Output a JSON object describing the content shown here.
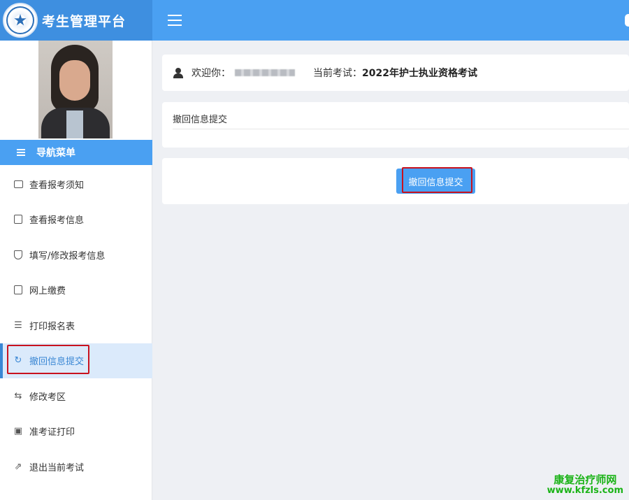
{
  "app": {
    "title": "考生管理平台"
  },
  "sidebar": {
    "nav_header": "导航菜单",
    "items": [
      {
        "label": "查看报考须知",
        "icon": "message-square-icon"
      },
      {
        "label": "查看报考信息",
        "icon": "document-icon"
      },
      {
        "label": "填写/修改报考信息",
        "icon": "shield-icon"
      },
      {
        "label": "网上缴费",
        "icon": "document-icon"
      },
      {
        "label": "打印报名表",
        "icon": "form-edit-icon"
      },
      {
        "label": "撤回信息提交",
        "icon": "refresh-icon",
        "active": true
      },
      {
        "label": "修改考区",
        "icon": "swap-icon"
      },
      {
        "label": "准考证打印",
        "icon": "image-icon"
      },
      {
        "label": "退出当前考试",
        "icon": "external-link-icon"
      }
    ]
  },
  "header": {
    "welcome_label": "欢迎你：",
    "exam_label": "当前考试：",
    "exam_name": "2022年护士执业资格考试"
  },
  "main": {
    "section_title": "撤回信息提交",
    "button_label": "撤回信息提交"
  },
  "watermark": {
    "line1": "康复治疗师网",
    "line2": "www.kfzls.com"
  },
  "colors": {
    "primary": "#4aa0f2",
    "active_bg": "#dbeafb",
    "highlight_border": "#c8121e",
    "watermark": "#1bb317"
  }
}
